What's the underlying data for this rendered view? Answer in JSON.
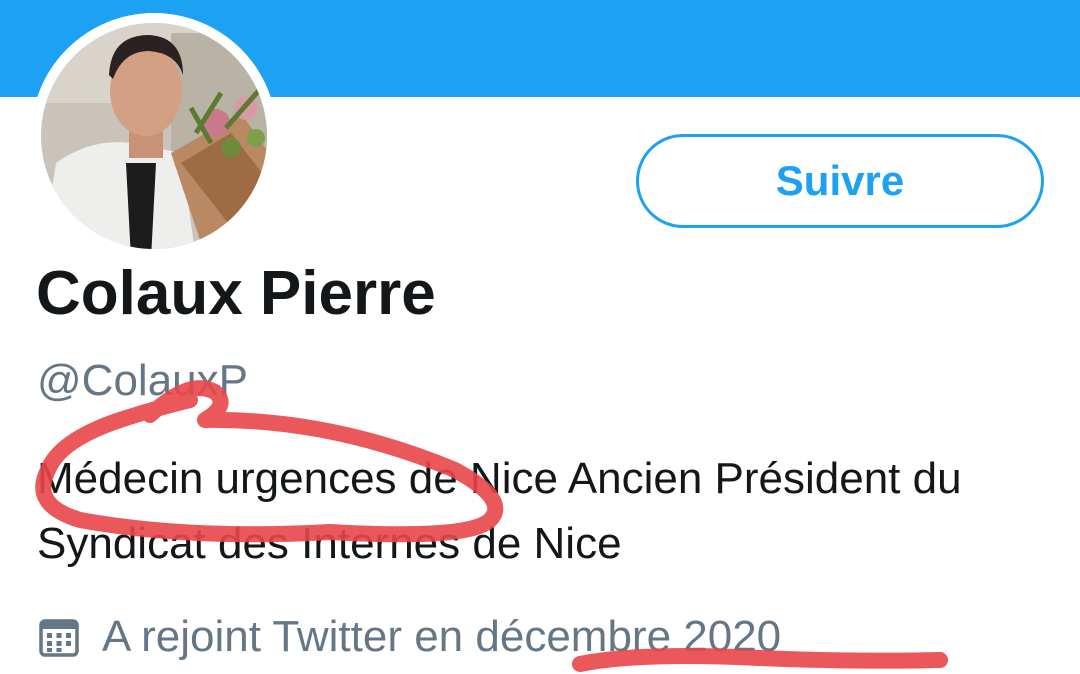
{
  "theme": {
    "banner_color": "#1da1f2",
    "accent": "#1da1f2",
    "annotation_color": "#e8464a"
  },
  "profile": {
    "name": "Colaux Pierre",
    "handle": "@ColauxP",
    "bio": "Médecin urgences de Nice  Ancien Président du Syndicat des Internes de Nice",
    "joined": "A rejoint Twitter en décembre 2020",
    "joined_icon": "calendar-icon"
  },
  "actions": {
    "follow_label": "Suivre"
  }
}
